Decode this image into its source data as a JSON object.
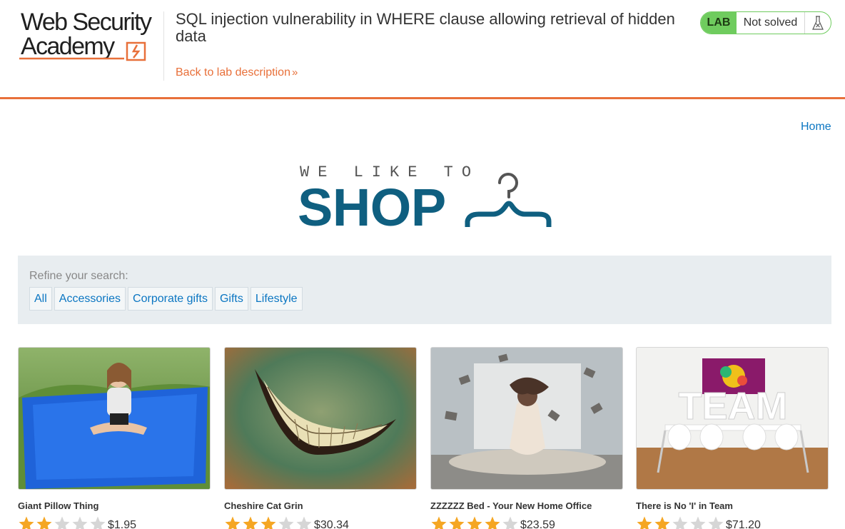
{
  "header": {
    "logo_line1": "Web Security",
    "logo_line2": "Academy",
    "lab_title": "SQL injection vulnerability in WHERE clause allowing retrieval of hidden data",
    "back_link": "Back to lab description",
    "lab_badge": "LAB",
    "lab_status": "Not solved",
    "flask_icon": "flask-icon"
  },
  "nav": {
    "home": "Home"
  },
  "shop_logo": {
    "tagline": "WE LIKE TO",
    "word": "SHOP",
    "icon": "hanger-icon"
  },
  "filter": {
    "label": "Refine your search:",
    "categories": [
      "All",
      "Accessories",
      "Corporate gifts",
      "Gifts",
      "Lifestyle"
    ]
  },
  "products": [
    {
      "name": "Giant Pillow Thing",
      "rating": 2,
      "max_rating": 5,
      "price": "$1.95"
    },
    {
      "name": "Cheshire Cat Grin",
      "rating": 3,
      "max_rating": 5,
      "price": "$30.34"
    },
    {
      "name": "ZZZZZZ Bed - Your New Home Office",
      "rating": 4,
      "max_rating": 5,
      "price": "$23.59"
    },
    {
      "name": "There is No 'I' in Team",
      "rating": 2,
      "max_rating": 5,
      "price": "$71.20"
    }
  ],
  "team_image_text": "TEAM",
  "colors": {
    "accent_orange": "#e8703a",
    "link_blue": "#0b76c2",
    "shop_blue": "#0f5f80",
    "lab_green": "#6fcc5e",
    "star_gold": "#f5a623",
    "star_grey": "#d6d6d6"
  }
}
